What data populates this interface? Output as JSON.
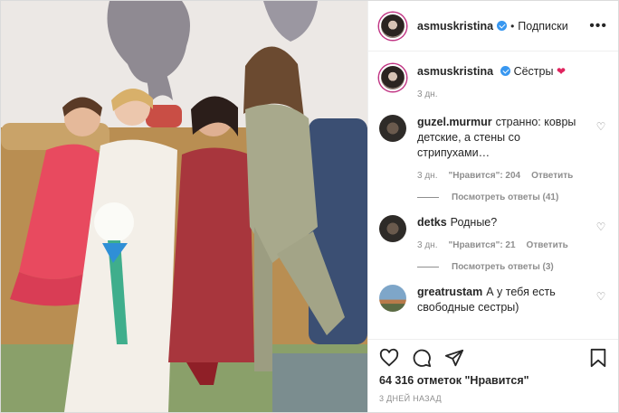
{
  "header": {
    "username": "asmuskristina",
    "separator": "•",
    "follow_label": "Подписки",
    "more_label": "•••"
  },
  "caption": {
    "username": "asmuskristina",
    "text": "Сёстры",
    "emoji": "❤",
    "time": "3 дн."
  },
  "comments": [
    {
      "username": "guzel.murmur",
      "text": "странно: ковры детские, а стены со стрипухами…",
      "time": "3 дн.",
      "likes": "\"Нравится\": 204",
      "reply_label": "Ответить",
      "view_replies": "Посмотреть ответы (41)"
    },
    {
      "username": "detks",
      "text": "Родные?",
      "time": "3 дн.",
      "likes": "\"Нравится\": 21",
      "reply_label": "Ответить",
      "view_replies": "Посмотреть ответы (3)"
    },
    {
      "username": "greatrustam",
      "text": "А у тебя есть свободные сестры)"
    }
  ],
  "icons": {
    "like": "heart-icon",
    "comment": "comment-icon",
    "share": "share-icon",
    "save": "bookmark-icon"
  },
  "likes_text": "64 316 отметок \"Нравится\"",
  "posted_ago": "3 ДНЕЙ НАЗАД",
  "colors": {
    "verified": "#3897f0",
    "heart": "#e0245e",
    "muted": "#8e8e8e",
    "text": "#262626"
  }
}
